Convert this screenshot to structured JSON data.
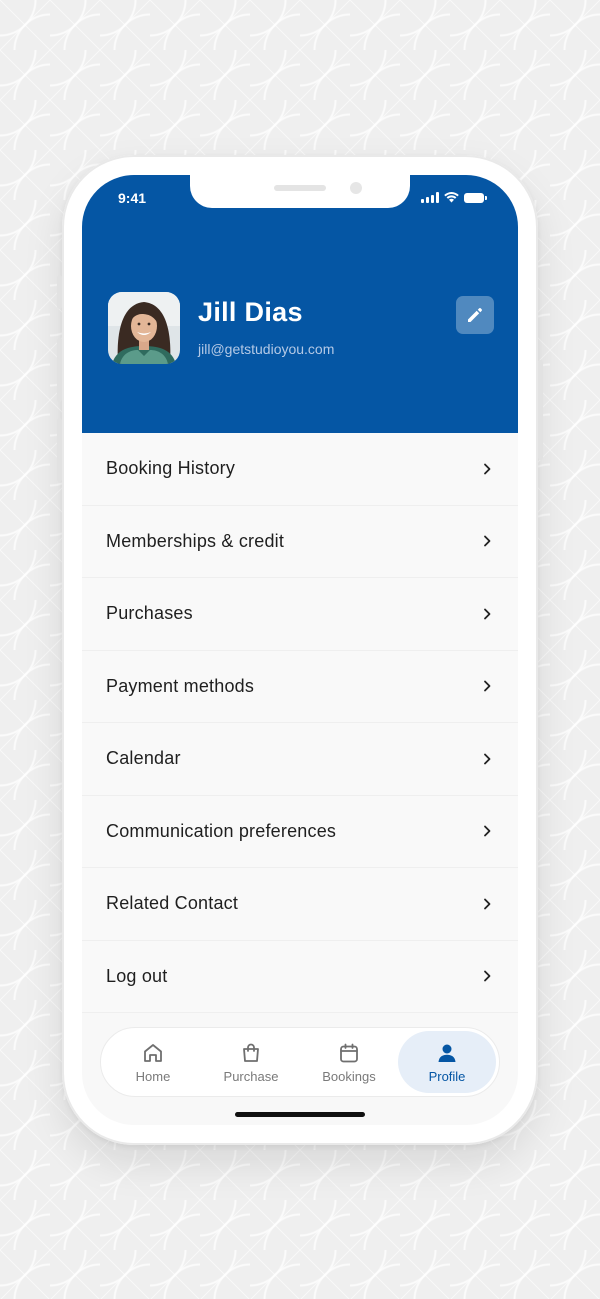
{
  "status_bar": {
    "time": "9:41"
  },
  "profile": {
    "name": "Jill Dias",
    "email": "jill@getstudioyou.com",
    "edit_icon": "pencil-icon"
  },
  "menu": {
    "items": [
      {
        "label": "Booking History"
      },
      {
        "label": "Memberships & credit"
      },
      {
        "label": "Purchases"
      },
      {
        "label": "Payment methods"
      },
      {
        "label": "Calendar"
      },
      {
        "label": "Communication preferences"
      },
      {
        "label": "Related Contact"
      },
      {
        "label": "Log out"
      }
    ]
  },
  "tabbar": {
    "tabs": [
      {
        "label": "Home",
        "icon": "home-icon",
        "active": false
      },
      {
        "label": "Purchase",
        "icon": "shopping-bag-icon",
        "active": false
      },
      {
        "label": "Bookings",
        "icon": "calendar-icon",
        "active": false
      },
      {
        "label": "Profile",
        "icon": "user-icon",
        "active": true
      }
    ]
  },
  "colors": {
    "brand": "#0556a4",
    "background": "#f8f8f8",
    "active_tab_bg": "#e6eef8",
    "inactive_tab": "#7a7a7a"
  }
}
